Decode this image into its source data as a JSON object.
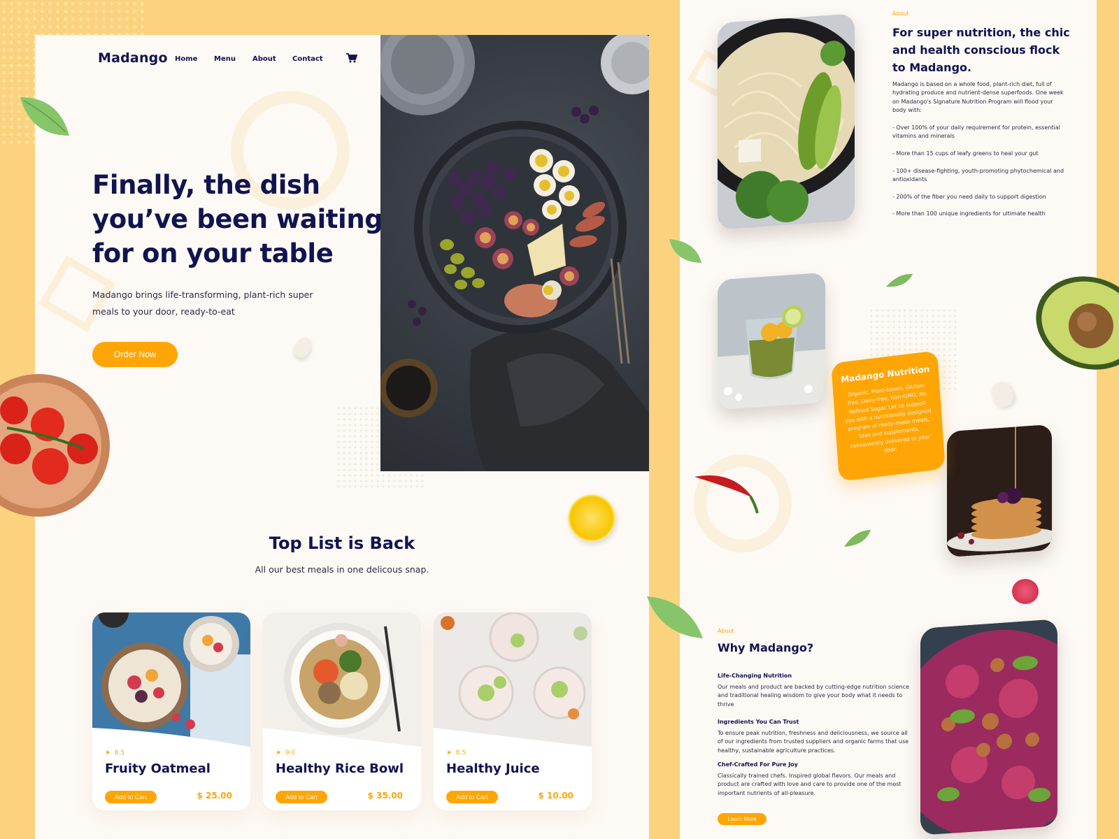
{
  "brand": {
    "name": "Madango",
    "accent": "#ffa506",
    "navy": "#101450",
    "background": "#fbd27e"
  },
  "nav": {
    "items": [
      "Home",
      "Menu",
      "About",
      "Contact"
    ],
    "cart_icon": "cart-icon"
  },
  "hero": {
    "title_line1": "Finally, the dish",
    "title_line2": "you’ve been waiting",
    "title_line3": "for on your table",
    "subtitle": "Madango brings life-transforming, plant-rich super meals to your door, ready-to-eat",
    "cta": "Order Now"
  },
  "top_list": {
    "title": "Top List is Back",
    "subtitle": "All our best meals in one delicous snap."
  },
  "cards": [
    {
      "rating": "8.5",
      "name": "Fruity Oatmeal",
      "button": "Add to Cart",
      "price": "$ 25.00"
    },
    {
      "rating": "9.0",
      "name": "Healthy Rice Bowl",
      "button": "Add to Cart",
      "price": "$ 35.00"
    },
    {
      "rating": "8.5",
      "name": "Healthy Juice",
      "button": "Add to Cart",
      "price": "$ 10.00"
    }
  ],
  "about": {
    "label": "About",
    "title": "For super nutrition, the chic and health conscious flock to Madango.",
    "intro": "Madango is based on a whole food, plant-rich diet, full of hydrating produce and nutrient-dense superfoods. One week on Madango's Signature Nutrition Program will flood your body with:",
    "bullets": [
      "- Over 100% of your daily requirement for protein, essential vitamins and minerals",
      "- More than 15 cups of leafy greens to heal your gut",
      "- 100+ disease-fighting, youth-promoting phytochemical and antioxidants",
      "- 200% of the fiber you need daily to support digestion",
      "- More than 100 unique ingredients for ultimate health"
    ]
  },
  "nutrition": {
    "title": "Madango Nutrition",
    "text": "Organic, Plant-based, Gluten-free, Dairy-free, Non-GMO, No Refined Sugar. Let us support you with a nutritionally designed program of ready-made meals, teas and supplements, conveniently delivered to your door."
  },
  "why": {
    "label": "About",
    "title": "Why Madango?",
    "items": [
      {
        "heading": "Life-Changing Nutrition",
        "text": "Our meals and product are backed by cutting-edge nutrition science and traditional healing wisdom to give your body what it needs to thrive"
      },
      {
        "heading": "Ingredients You Can Trust",
        "text": "To ensure peak nutrition, freshness and deliciousness, we source all of our ingredients from trusted suppliers and organic farms that use healthy, sustainable agriculture practices."
      },
      {
        "heading": "Chef-Crafted For Pure Joy",
        "text": "Classically trained chefs. Inspired global flavors. Our meals and product are crafted with love and care to provide one of the most important nutrients of all-pleasure."
      }
    ],
    "button": "Learn More"
  }
}
